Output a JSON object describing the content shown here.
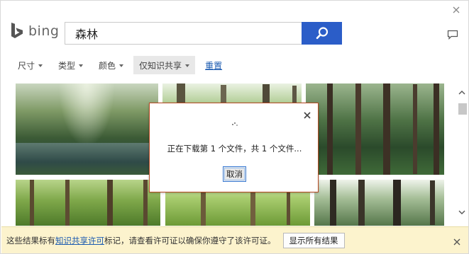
{
  "brand": {
    "name": "bing",
    "logo_icon": "bing-logo-icon",
    "accent": "#2b5dc8"
  },
  "search": {
    "value": "森林",
    "placeholder": "",
    "button_icon": "search-icon"
  },
  "filters": [
    {
      "label": "尺寸",
      "has_caret": true
    },
    {
      "label": "类型",
      "has_caret": true
    },
    {
      "label": "颜色",
      "has_caret": true
    },
    {
      "label": "仅知识共享",
      "has_caret": true,
      "active": true
    }
  ],
  "reset_label": "重置",
  "dialog": {
    "message": "正在下载第 1 个文件，共 1 个文件...",
    "cancel_label": "取消",
    "border_color": "#b74a22"
  },
  "info_bar": {
    "text_before": "这些结果标有",
    "link_text": "知识共享许可",
    "text_after": "标记，请查看许可证以确保你遵守了该许可证。",
    "button_label": "显示所有结果",
    "background": "#fcf3cd"
  }
}
